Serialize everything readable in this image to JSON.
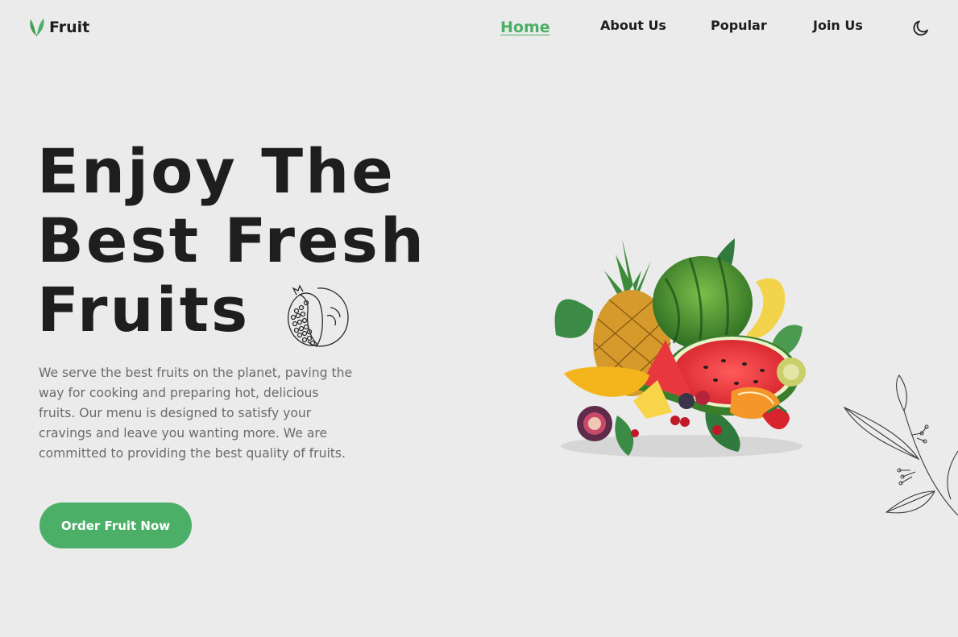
{
  "brand": {
    "name": "Fruit",
    "logo_icon": "leaf-icon"
  },
  "nav": {
    "items": [
      {
        "label": "Home",
        "active": true
      },
      {
        "label": "About Us",
        "active": false
      },
      {
        "label": "Popular",
        "active": false
      },
      {
        "label": "Join Us",
        "active": false
      }
    ],
    "theme_toggle_icon": "moon-icon"
  },
  "hero": {
    "headline_lines": [
      "Enjoy The",
      "Best Fresh",
      "Fruits"
    ],
    "description": "We serve the best fruits on the planet, paving the way for cooking and preparing hot, delicious fruits. Our menu is designed to satisfy your cravings and leave you wanting more. We are committed to providing the best quality of fruits.",
    "cta_label": "Order Fruit Now",
    "headline_icon": "pomegranate-icon",
    "image_icon": "fruit-bowl-image",
    "decoration_icon": "branch-icon"
  },
  "colors": {
    "accent": "#4caf67",
    "background": "#ebebeb",
    "text": "#1d1d1d",
    "muted": "#6b6b6b"
  }
}
